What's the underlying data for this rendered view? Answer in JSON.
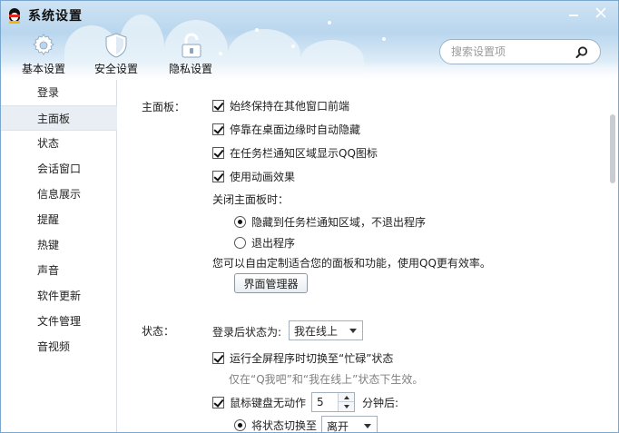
{
  "window": {
    "title": "系统设置"
  },
  "nav_tabs": [
    {
      "label": "基本设置",
      "icon": "gear-icon"
    },
    {
      "label": "安全设置",
      "icon": "shield-icon"
    },
    {
      "label": "隐私设置",
      "icon": "lock-icon"
    }
  ],
  "search": {
    "placeholder": "搜索设置项",
    "icon": "search-icon"
  },
  "sidebar": {
    "items": [
      {
        "label": "登录"
      },
      {
        "label": "主面板",
        "active": true
      },
      {
        "label": "状态"
      },
      {
        "label": "会话窗口"
      },
      {
        "label": "信息展示"
      },
      {
        "label": "提醒"
      },
      {
        "label": "热键"
      },
      {
        "label": "声音"
      },
      {
        "label": "软件更新"
      },
      {
        "label": "文件管理"
      },
      {
        "label": "音视频"
      }
    ]
  },
  "main_panel": {
    "section_label": "主面板：",
    "options": [
      {
        "label": "始终保持在其他窗口前端",
        "checked": true
      },
      {
        "label": "停靠在桌面边缘时自动隐藏",
        "checked": true
      },
      {
        "label": "在任务栏通知区域显示QQ图标",
        "checked": true
      },
      {
        "label": "使用动画效果",
        "checked": true
      }
    ],
    "close_label": "关闭主面板时：",
    "close_options": [
      {
        "label": "隐藏到任务栏通知区域，不退出程序",
        "selected": true
      },
      {
        "label": "退出程序",
        "selected": false
      }
    ],
    "customize_text": "您可以自由定制适合您的面板和功能，使用QQ更有效率。",
    "manager_button": "界面管理器"
  },
  "status_section": {
    "section_label": "状态：",
    "after_login_label": "登录后状态为:",
    "after_login_value": "我在线上",
    "fullscreen_option": {
      "label": "运行全屏程序时切换至“忙碌”状态",
      "checked": true
    },
    "fullscreen_hint": "仅在“Q我吧”和“我在线上”状态下生效。",
    "idle_option": {
      "label": "鼠标键盘无动作",
      "checked": true
    },
    "idle_minutes": "5",
    "idle_suffix": "分钟后:",
    "switch_option": {
      "label": "将状态切换至",
      "selected": true
    },
    "switch_value": "离开"
  },
  "colors": {
    "border": "#7aa7cf",
    "sidebar_active": "#e8eef4",
    "hint_text": "#808080"
  }
}
